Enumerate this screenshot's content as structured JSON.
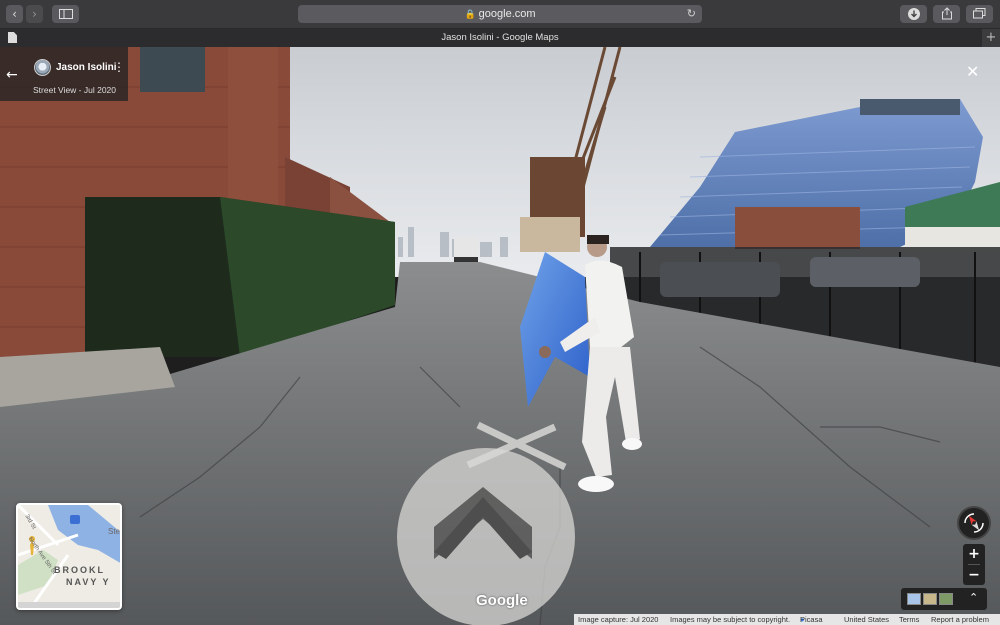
{
  "browser": {
    "url": "google.com",
    "tab_title": "Jason Isolini - Google Maps",
    "back_icon": "chevron-left-icon",
    "forward_icon": "chevron-right-icon",
    "sidebar_icon": "sidebar-icon",
    "lock_icon": "lock-icon",
    "reload_icon": "reload-icon",
    "download_icon": "download-icon",
    "share_icon": "share-icon",
    "tabs_icon": "tabs-icon",
    "new_tab_icon": "plus-icon"
  },
  "streetview": {
    "author": "Jason Isolini",
    "subtitle": "Street View - Jul 2020",
    "close_icon": "close-icon",
    "back_icon": "arrow-left-icon",
    "menu_icon": "kebab-icon"
  },
  "minimap": {
    "labels": [
      "BROOKL",
      "NAVY Y",
      "Ste",
      "3rd St",
      "North Ave 5th St"
    ]
  },
  "controls": {
    "zoom_in": "+",
    "zoom_out": "−",
    "compass_icon": "compass-icon",
    "expand_icon": "chevron-up-icon"
  },
  "brand": {
    "logo": "Google"
  },
  "footer": {
    "capture": "Image capture: Jul 2020",
    "copyright": "Images may be subject to copyright.",
    "picasa": "Picasa",
    "country": "United States",
    "terms": "Terms",
    "report": "Report a problem"
  }
}
